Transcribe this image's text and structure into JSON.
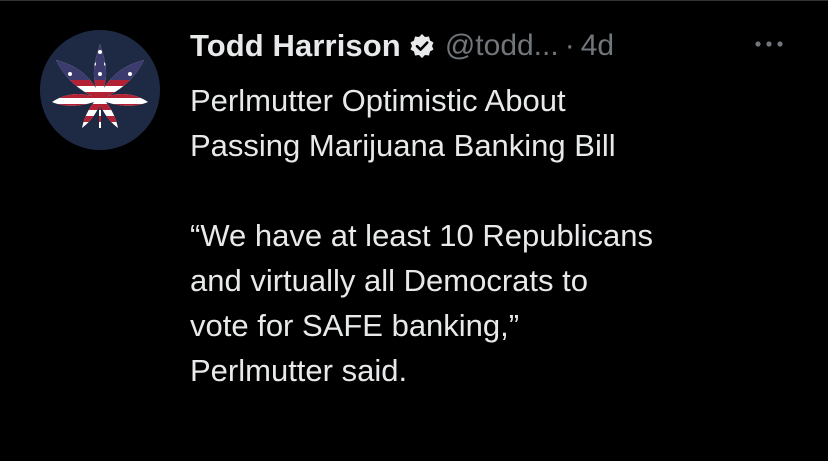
{
  "tweet": {
    "author": {
      "display_name": "Todd Harrison",
      "handle": "@todd...",
      "verified": true,
      "verified_icon": "verified-badge-icon",
      "avatar_icon": "flag-leaf-avatar"
    },
    "separator": "·",
    "timestamp": "4d",
    "more_icon": "more-options-icon",
    "text": "Perlmutter Optimistic About\nPassing Marijuana Banking Bill\n\n“We have at least 10 Republicans\nand virtually all Democrats to\nvote for SAFE banking,”\nPerlmutter said."
  },
  "colors": {
    "background": "#000000",
    "primary_text": "#e7e9ea",
    "secondary_text": "#71767b",
    "flag_red": "#b22234",
    "flag_blue": "#3c3b6e"
  }
}
